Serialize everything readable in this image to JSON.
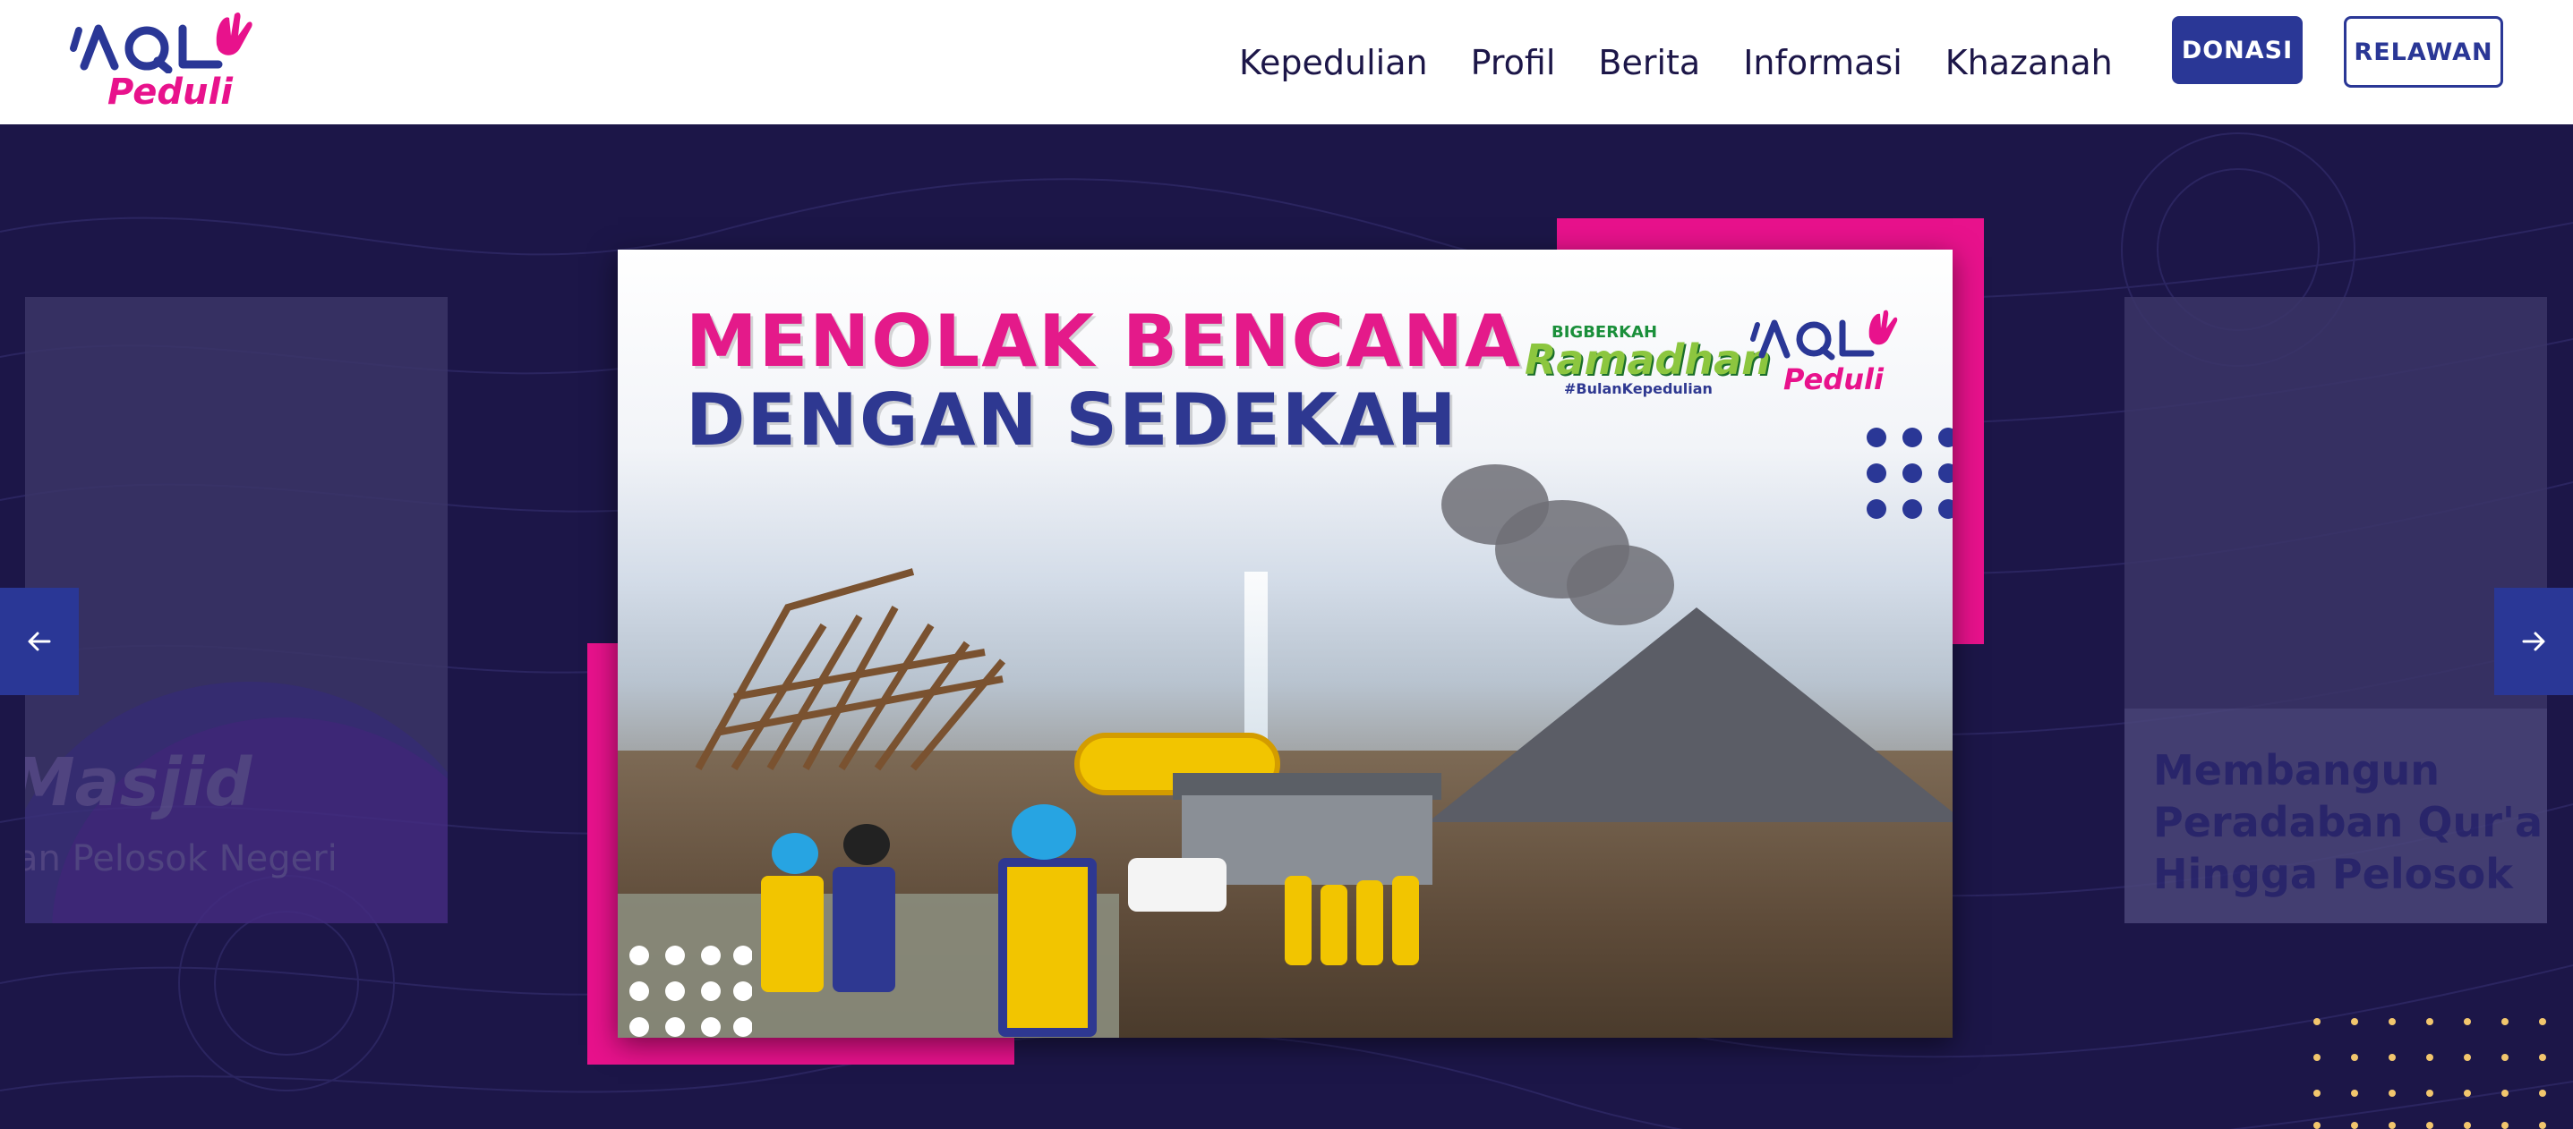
{
  "header": {
    "logo": {
      "mark": "AQL",
      "text": "Peduli"
    },
    "nav": [
      "Kepedulian",
      "Profil",
      "Berita",
      "Informasi",
      "Khazanah"
    ],
    "donasi_label": "DONASI",
    "relawan_label": "RELAWAN"
  },
  "hero": {
    "prev_icon": "arrow-left-icon",
    "next_icon": "arrow-right-icon",
    "left_slide": {
      "title": "Masjid",
      "subtitle": "an Pelosok Negeri"
    },
    "right_slide": {
      "lines": [
        "Membangun",
        "Peradaban Qur'a",
        "Hingga Pelosok"
      ]
    },
    "main_slide": {
      "title_line1": "MENOLAK BENCANA",
      "title_line2": "DENGAN SEDEKAH",
      "badge_campaign": {
        "small": "BIGBERKAH",
        "main": "Ramadhan",
        "tag": "#BulanKepedulian"
      },
      "badge_logo": {
        "mark": "AQL",
        "text": "Peduli"
      }
    }
  },
  "colors": {
    "brand_pink": "#e8128c",
    "brand_blue": "#2a3796",
    "hero_bg": "#1c1648",
    "nav_text": "#1c1648"
  }
}
